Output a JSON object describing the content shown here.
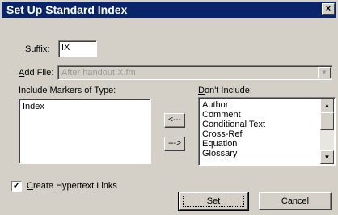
{
  "window": {
    "title": "Set Up Standard Index",
    "close_glyph": "×"
  },
  "suffix": {
    "label_u": "S",
    "label_rest": "uffix:",
    "value": "IX"
  },
  "add_file": {
    "label_u": "A",
    "label_rest": "dd File:",
    "value": "After handoutIX.fm",
    "arrow": "▼"
  },
  "include": {
    "label": "Include Markers of Type:",
    "items": [
      "Index"
    ]
  },
  "exclude": {
    "label_u": "D",
    "label_rest": "on't Include:",
    "items": [
      "Author",
      "Comment",
      "Conditional Text",
      "Cross-Ref",
      "Equation",
      "Glossary"
    ]
  },
  "move_left": "<---",
  "move_right": "--->",
  "scroll": {
    "up": "▲",
    "down": "▼"
  },
  "hypertext": {
    "checked": "✓",
    "label_u": "C",
    "label_rest": "reate Hypertext Links"
  },
  "buttons": {
    "set": "Set",
    "cancel": "Cancel"
  }
}
